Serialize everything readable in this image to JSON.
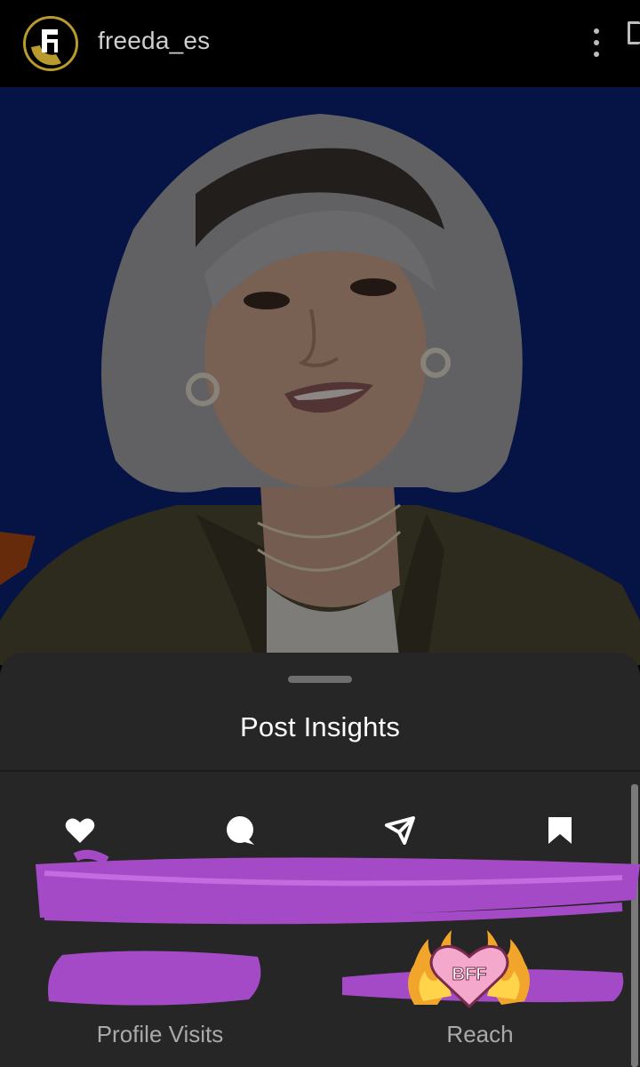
{
  "header": {
    "username": "freeda_es",
    "avatar_icon": "freeda-logo-icon",
    "menu_icon": "more-vertical-icon",
    "brand_color": "#b99a2c"
  },
  "sheet": {
    "title": "Post Insights",
    "icons": [
      "heart-icon",
      "comment-icon",
      "share-icon",
      "bookmark-icon"
    ],
    "metrics": [
      {
        "label": "Profile Visits"
      },
      {
        "label": "Reach"
      }
    ],
    "sticker_text": "BFF",
    "redaction_color": "#a54ac6",
    "background": "#262626"
  }
}
